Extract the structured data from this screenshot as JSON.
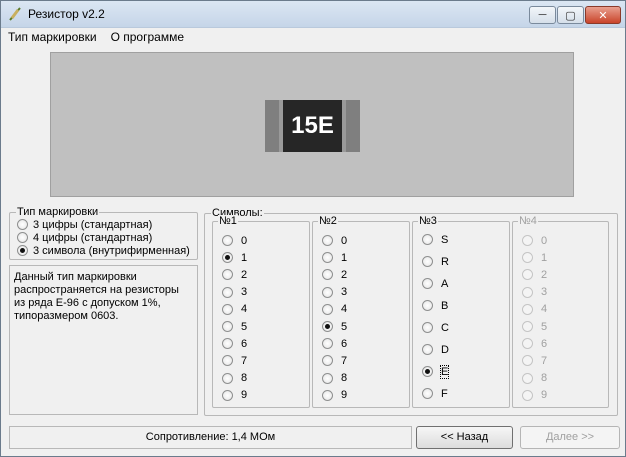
{
  "window": {
    "title": "Резистор v2.2",
    "minimize_label": "─",
    "maximize_label": "▢",
    "close_label": "✕"
  },
  "menu": [
    "Тип маркировки",
    "О программе"
  ],
  "preview": {
    "code": "15E"
  },
  "marking_type": {
    "legend": "Тип маркировки",
    "options": [
      {
        "label": "3 цифры (стандартная)",
        "checked": false
      },
      {
        "label": "4 цифры (стандартная)",
        "checked": false
      },
      {
        "label": "3 символа (внутрифирменная)",
        "checked": true
      }
    ]
  },
  "info_text": "Данный тип маркировки распространяется на резисторы из ряда Е-96 с допуском 1%, типоразмером 0603.",
  "symbols": {
    "legend": "Символы:",
    "groups": [
      {
        "title": "№1",
        "options": [
          "0",
          "1",
          "2",
          "3",
          "4",
          "5",
          "6",
          "7",
          "8",
          "9"
        ],
        "selected": "1",
        "disabled": false
      },
      {
        "title": "№2",
        "options": [
          "0",
          "1",
          "2",
          "3",
          "4",
          "5",
          "6",
          "7",
          "8",
          "9"
        ],
        "selected": "5",
        "disabled": false
      },
      {
        "title": "№3",
        "options": [
          "S",
          "R",
          "A",
          "B",
          "C",
          "D",
          "E",
          "F"
        ],
        "selected": "E",
        "disabled": false
      },
      {
        "title": "№4",
        "options": [
          "0",
          "1",
          "2",
          "3",
          "4",
          "5",
          "6",
          "7",
          "8",
          "9"
        ],
        "selected": "",
        "disabled": true
      }
    ]
  },
  "status": "Сопротивление: 1,4 МОм",
  "buttons": {
    "back": "<< Назад",
    "next": "Далее >>"
  }
}
